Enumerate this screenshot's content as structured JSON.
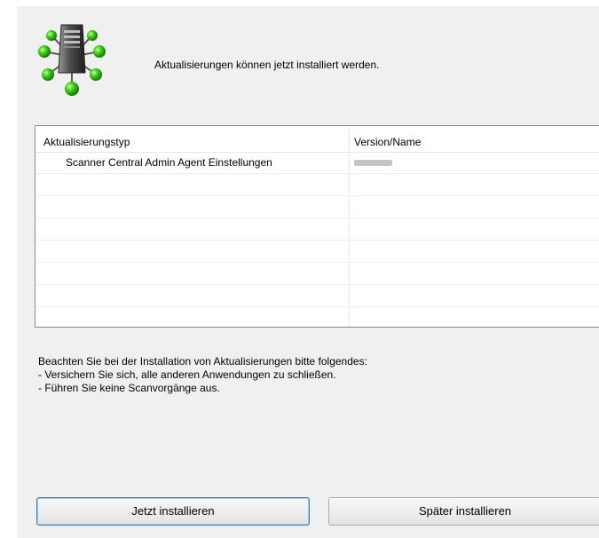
{
  "header": {
    "message": "Aktualisierungen können jetzt installiert werden."
  },
  "list": {
    "columns": [
      "Aktualisierungstyp",
      "Version/Name"
    ],
    "rows": [
      {
        "type": "Scanner Central Admin Agent Einstellungen",
        "version": ""
      }
    ]
  },
  "notes": {
    "lines": [
      "Beachten Sie bei der Installation von Aktualisierungen bitte folgendes:",
      "- Versichern Sie sich, alle anderen Anwendungen zu schließen.",
      "- Führen Sie keine Scanvorgänge aus."
    ]
  },
  "buttons": {
    "install_now": "Jetzt installieren",
    "install_later": "Später installieren"
  },
  "icons": {
    "header": "server-network-icon"
  },
  "colors": {
    "node_green": "#3fcf1a",
    "dialog_bg": "#f0f0f0",
    "primary_border": "#3c7fb1"
  }
}
